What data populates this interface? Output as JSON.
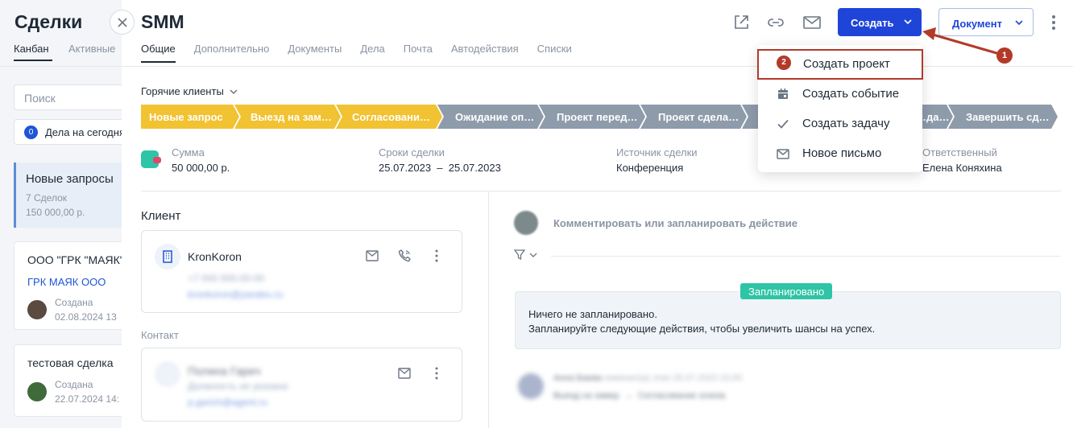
{
  "background": {
    "title": "Сделки",
    "tabs": [
      "Канбан",
      "Активные"
    ],
    "search_placeholder": "Поиск",
    "today_chip": {
      "count": "0",
      "label": "Дела на сегодня"
    },
    "column": {
      "title": "Новые запросы",
      "count": "7 Сделок",
      "sum": "150 000,00 р."
    },
    "cards": [
      {
        "title": "ООО \"ГРК \"МАЯК\"",
        "link": "ГРК МАЯК ООО",
        "created_label": "Создана",
        "created_date": "02.08.2024 13"
      },
      {
        "title": "тестовая сделка",
        "created_label": "Создана",
        "created_date": "22.07.2024 14:"
      }
    ]
  },
  "deal": {
    "title": "SMM",
    "tabs": [
      "Общие",
      "Дополнительно",
      "Документы",
      "Дела",
      "Почта",
      "Автодействия",
      "Списки"
    ],
    "create_label": "Создать",
    "document_label": "Документ",
    "funnel": "Горячие клиенты",
    "stages": [
      {
        "label": "Новые запрос",
        "color": "#f1c232"
      },
      {
        "label": "Выезд на зам…",
        "color": "#f1c232"
      },
      {
        "label": "Согласовани…",
        "color": "#f1c232"
      },
      {
        "label": "Ожидание оп…",
        "color": "#8e9bab"
      },
      {
        "label": "Проект перед…",
        "color": "#8e9bab"
      },
      {
        "label": "Проект сдела…",
        "color": "#8e9bab"
      },
      {
        "label": "",
        "color": "#8e9bab"
      },
      {
        "label": "…да…",
        "color": "#8e9bab"
      },
      {
        "label": "Завершить сд…",
        "color": "#8e9bab"
      }
    ],
    "info": {
      "sum_label": "Сумма",
      "sum_value": "50 000,00 р.",
      "dates_label": "Сроки сделки",
      "dates_value": "25.07.2023  –  25.07.2023",
      "source_label": "Источник сделки",
      "source_value": "Конференция",
      "owner_label": "Ответственный",
      "owner_value": "Елена Коняхина"
    },
    "client": {
      "section": "Клиент",
      "name": "KronKoron",
      "phone": "+7 000 000-00-00",
      "email": "kronkoron@yandex.ru"
    },
    "contact": {
      "section": "Контакт",
      "name": "Полина Гарич",
      "position": "Должность не указана",
      "email": "p.garich@agent.ru"
    },
    "activity": {
      "comment_placeholder": "Комментировать или запланировать действие",
      "planned_badge": "Запланировано",
      "empty_line1": "Ничего не запланировано.",
      "empty_line2": "Запланируйте следующие действия, чтобы увеличить шансы на успех.",
      "history_name": "Анна Баева",
      "history_meta": "изменил(а) этап 25.07.2023 15:00",
      "history_text": "Выезд на замер  →  Согласование эскиза"
    }
  },
  "menu": {
    "items": [
      {
        "label": "Создать проект",
        "icon": "project-icon"
      },
      {
        "label": "Создать событие",
        "icon": "calendar-icon"
      },
      {
        "label": "Создать задачу",
        "icon": "check-icon"
      },
      {
        "label": "Новое письмо",
        "icon": "mail-icon"
      }
    ]
  },
  "annotations": {
    "step1": "1",
    "step2": "2",
    "color": "#b33a2a"
  }
}
